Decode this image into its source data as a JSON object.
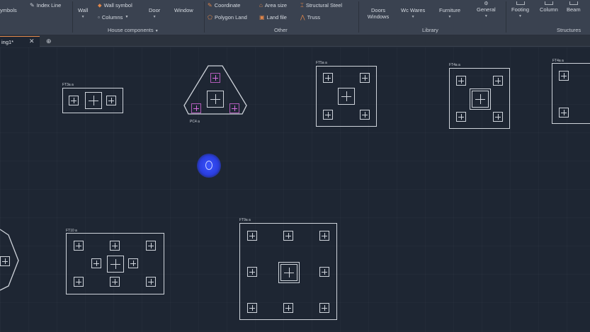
{
  "ribbon": {
    "left_items": [
      {
        "label": "ymbols",
        "icon": "symbols-icon"
      },
      {
        "label": "Index Line",
        "icon": "index-line-icon"
      }
    ],
    "house_components": {
      "group_label": "House components",
      "wall": "Wall",
      "wall_symbol": "Wall symbol",
      "columns": "Columns",
      "door": "Door",
      "window": "Window"
    },
    "other": {
      "group_label": "Other",
      "coordinate": "Coordinate",
      "polygon_land": "Polygon Land",
      "area_size": "Area size",
      "land_file": "Land file",
      "structural_steel": "Structural Steel",
      "truss": "Truss"
    },
    "library": {
      "group_label": "Library",
      "doors_windows": "Doors Windows",
      "wc_wares": "Wc Wares",
      "furniture": "Furniture",
      "general": "General"
    },
    "structures": {
      "group_label": "Structures",
      "footing": "Footing",
      "column": "Column",
      "beam": "Beam"
    }
  },
  "tabs": {
    "active_tab": "ing1*",
    "close_glyph": "✕",
    "add_glyph": "⊕"
  },
  "canvas": {
    "footings": [
      {
        "label": "FT3a a"
      },
      {
        "label": "PC4 a"
      },
      {
        "label": "FT5a a"
      },
      {
        "label": "FT4a a"
      },
      {
        "label": "FT4a a"
      },
      {
        "label": "FT10 a"
      },
      {
        "label": "FT9a a"
      }
    ]
  },
  "colors": {
    "ribbon_bg": "#3a4250",
    "canvas_bg": "#1e2633",
    "accent_orange": "#e2874a",
    "cad_line": "#cfd4db",
    "pile_magenta": "#d86ce0",
    "cursor_blue": "#2a3de0"
  }
}
